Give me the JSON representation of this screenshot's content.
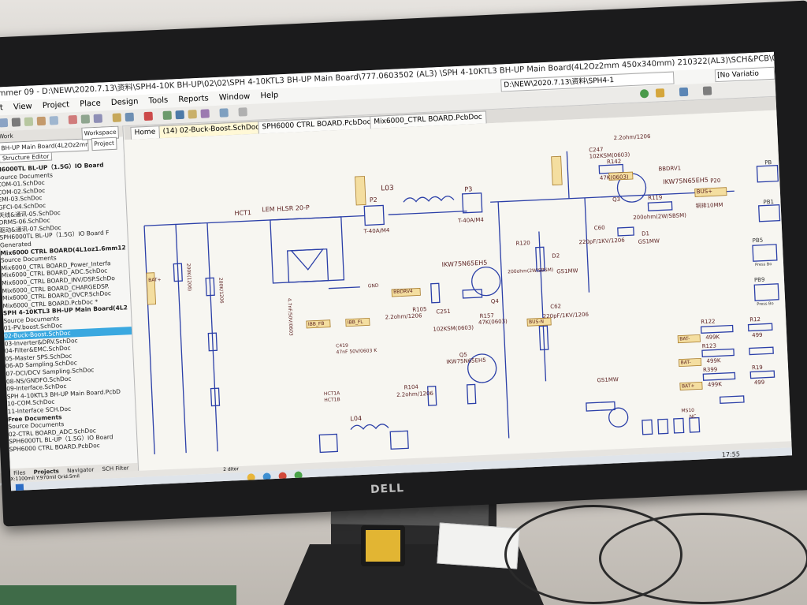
{
  "photo": {
    "monitor_brand": "DELL"
  },
  "window": {
    "title": "ummer 09 - D:\\NEW\\2020.7.13\\资料\\SPH4-10K BH-UP\\02\\02\\SPH 4-10KTL3 BH-UP Main Board\\777.0603502 (AL3) \\SPH 4-10KTL3 BH-UP Main Board(4L2Oz2mm 450x340mm) 210322(AL3)\\SCH&PCB\\02-Buck-Boost.SchDoc - SP...",
    "path_box": "D:\\NEW\\2020.7.13\\资料\\SPH4-1",
    "variation_box": "[No Variatio"
  },
  "menu": [
    "it",
    "View",
    "Project",
    "Place",
    "Design",
    "Tools",
    "Reports",
    "Window",
    "Help"
  ],
  "tabs": [
    "Home",
    "(14) 02-Buck-Boost.SchDoc",
    "SPH6000 CTRL BOARD.PcbDoc",
    "Mix6000_CTRL BOARD.PcbDoc"
  ],
  "panel": {
    "header_left": "Work",
    "header_right": "Workspace",
    "project_box": "BH-UP Main Board(4L2Oz2mm 450",
    "project_button": "Project",
    "structure_editor": "Structure Editor",
    "tree": [
      {
        "text": "H6000TL BL-UP（1.5G）IO Board",
        "style": "bold"
      },
      {
        "text": "  Source Documents",
        "style": ""
      },
      {
        "text": "    COM-01.SchDoc",
        "style": ""
      },
      {
        "text": "    COM-02.SchDoc",
        "style": ""
      },
      {
        "text": "    EMI-03.SchDoc",
        "style": ""
      },
      {
        "text": "    GFCI-04.SchDoc",
        "style": ""
      },
      {
        "text": "    天线&通讯-05.SchDoc",
        "style": ""
      },
      {
        "text": "    DRMS-06.SchDoc",
        "style": ""
      },
      {
        "text": "    驱动&通讯-07.SchDoc",
        "style": ""
      },
      {
        "text": "    SPH6000TL BL-UP（1.5G）IO Board F",
        "style": ""
      },
      {
        "text": "  Generated",
        "style": ""
      },
      {
        "text": "Mix6000 CTRL BOARD(4L1oz1.6mm12",
        "style": "bold"
      },
      {
        "text": "  Source Documents",
        "style": ""
      },
      {
        "text": "    Mix6000_CTRL BOARD_Power_Interfa",
        "style": ""
      },
      {
        "text": "    Mix6000_CTRL BOARD_ADC.SchDoc",
        "style": ""
      },
      {
        "text": "    Mix6000_CTRL BOARD_INV/DSP.SchDo",
        "style": ""
      },
      {
        "text": "    Mix6000_CTRL BOARD_CHARGEDSP.",
        "style": ""
      },
      {
        "text": "    Mix6000_CTRL BOARD_OVCP.SchDoc",
        "style": ""
      },
      {
        "text": "    Mix6000_CTRL BOARD.PcbDoc *",
        "style": ""
      },
      {
        "text": "SPH 4-10KTL3 BH-UP Main Board(4L2",
        "style": "bold"
      },
      {
        "text": "  Source Documents",
        "style": ""
      },
      {
        "text": "    01-PV.boost.SchDoc",
        "style": ""
      },
      {
        "text": "    02-Buck-Boost.SchDoc",
        "style": "sel"
      },
      {
        "text": "    03-Inverter&DRV.SchDoc",
        "style": ""
      },
      {
        "text": "    04-Filter&EMC.SchDoc",
        "style": ""
      },
      {
        "text": "    05-Master SPS.SchDoc",
        "style": ""
      },
      {
        "text": "    06-AD Sampling.SchDoc",
        "style": ""
      },
      {
        "text": "    07-DCI/DCV Sampling.SchDoc",
        "style": ""
      },
      {
        "text": "    08-NS/GNDFO.SchDoc",
        "style": ""
      },
      {
        "text": "    09-Interface.SchDoc",
        "style": ""
      },
      {
        "text": "    SPH 4-10KTL3 BH-UP Main Board.PcbD",
        "style": ""
      },
      {
        "text": "    10-COM.SchDoc",
        "style": ""
      },
      {
        "text": "    11-Interface SCH.Doc",
        "style": ""
      },
      {
        "text": "Free Documents",
        "style": "bold"
      },
      {
        "text": "  Source Documents",
        "style": ""
      },
      {
        "text": "    02-CTRL BOARD_ADC.SchDoc",
        "style": ""
      },
      {
        "text": "    SPH6000TL BL-UP（1.5G）IO Board",
        "style": ""
      },
      {
        "text": "    SPH6000 CTRL BOARD.PcbDoc",
        "style": ""
      }
    ],
    "bottom_tabs": [
      "Files",
      "Projects",
      "Navigator",
      "SCH Filter"
    ]
  },
  "schematic": {
    "labels": {
      "hct1": "HCT1",
      "lem": "LEM HLSR 20-P",
      "l03": "L03",
      "p2": "P2",
      "p2_part": "T-40A/M4",
      "p3": "P3",
      "p3_part": "T-40A/M4",
      "c247": "C247",
      "c247_val": "102KSM(0603)",
      "r142": "R142",
      "r142_val": "47K(0603)",
      "r_top": "2.2ohm/1206",
      "bbdrv1": "BBDRV1",
      "ikw_top": "IKW75N65EH5",
      "bus": "BUS+",
      "q3": "Q3",
      "r119": "R119",
      "r119_val": "200ohm(2W/SBSM)",
      "c60": "C60",
      "c60_val": "220pF/1KV/1206",
      "d1": "D1",
      "d1_val": "GS1MW",
      "p20": "P20",
      "copper": "铜排10MM",
      "ikw_mid": "IKW75N65EH5",
      "bbdrv4": "BBDRV4",
      "q4": "Q4",
      "r105": "R105",
      "r105_val": "2.2ohm/1206",
      "c251": "C251",
      "c251_val": "102KSM(0603)",
      "r157": "R157",
      "r157_val": "47K(0603)",
      "c62": "C62",
      "c62_val": "220pF/1KV/1206",
      "r120": "R120",
      "r120_val": "200ohm(2W/SBSM)",
      "d2": "D2",
      "d2_val": "GS1MW",
      "bat_plus": "BAT+",
      "bat_minus": "BAT-",
      "buckn": "BUS-N",
      "l04": "L04",
      "ikw_low": "IKW75N65EH5",
      "q5": "Q5",
      "r104": "R104",
      "r104_val": "2.2ohm/1206",
      "gs1mw": "GS1MW",
      "r121": "R121",
      "r122": "R122",
      "r122_val": "499K",
      "r123": "R123",
      "r123_val": "499K",
      "r12x": "R12",
      "r12x_val": "499",
      "r399": "R399",
      "r399_val": "499K",
      "r19": "R19",
      "r19_val": "499",
      "gnd": "GND",
      "ibb_fb1": "IBB_FB",
      "ibb_fb2": "IBB_FL",
      "hct1a": "HCT1A",
      "hct1b": "HCT1B",
      "c419": "C419",
      "c419_val": "47nF 50V/0603 K",
      "pb5": "PB5",
      "pb9": "PB9",
      "press": "Press Bo",
      "pb": "PB",
      "pb1": "PB1",
      "ms10": "MS10",
      "nc": "NC",
      "bat_plus_f": "BAT+",
      "r_vals_a": "200K(1206)",
      "r_vals_b": "200K/1206",
      "r_vals_c": "4.7nF/50V/0603"
    }
  },
  "statusbar": {
    "text": "X:1100mil Y:970mil   Grid:5mil",
    "sheet_tab": "2 ditor"
  },
  "taskbar": {
    "clock": "17:55"
  }
}
